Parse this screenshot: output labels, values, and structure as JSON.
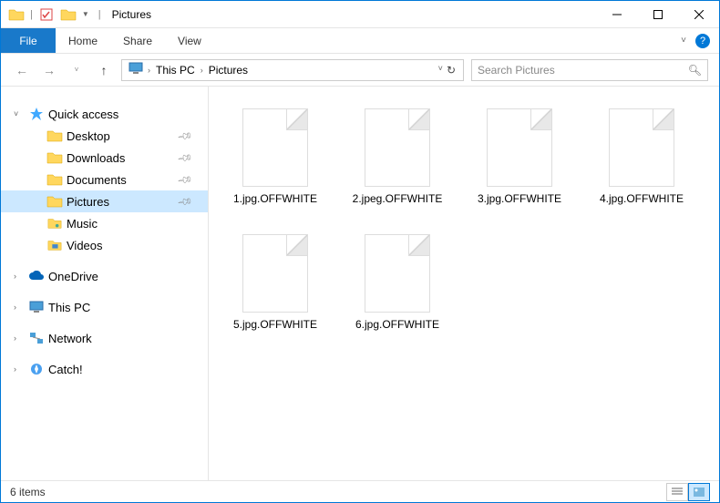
{
  "title": {
    "separator": "|",
    "text": "Pictures"
  },
  "ribbon": {
    "file": "File",
    "tabs": [
      "Home",
      "Share",
      "View"
    ]
  },
  "breadcrumb": {
    "items": [
      "This PC",
      "Pictures"
    ]
  },
  "search": {
    "placeholder": "Search Pictures"
  },
  "sidebar": {
    "quick_access": "Quick access",
    "items": [
      {
        "label": "Desktop",
        "pinned": true
      },
      {
        "label": "Downloads",
        "pinned": true
      },
      {
        "label": "Documents",
        "pinned": true
      },
      {
        "label": "Pictures",
        "pinned": true,
        "selected": true
      },
      {
        "label": "Music",
        "pinned": false
      },
      {
        "label": "Videos",
        "pinned": false
      }
    ],
    "onedrive": "OneDrive",
    "this_pc": "This PC",
    "network": "Network",
    "catch": "Catch!"
  },
  "files": [
    {
      "name": "1.jpg.OFFWHITE"
    },
    {
      "name": "2.jpeg.OFFWHITE"
    },
    {
      "name": "3.jpg.OFFWHITE"
    },
    {
      "name": "4.jpg.OFFWHITE"
    },
    {
      "name": "5.jpg.OFFWHITE"
    },
    {
      "name": "6.jpg.OFFWHITE"
    }
  ],
  "status": {
    "count": "6 items"
  }
}
